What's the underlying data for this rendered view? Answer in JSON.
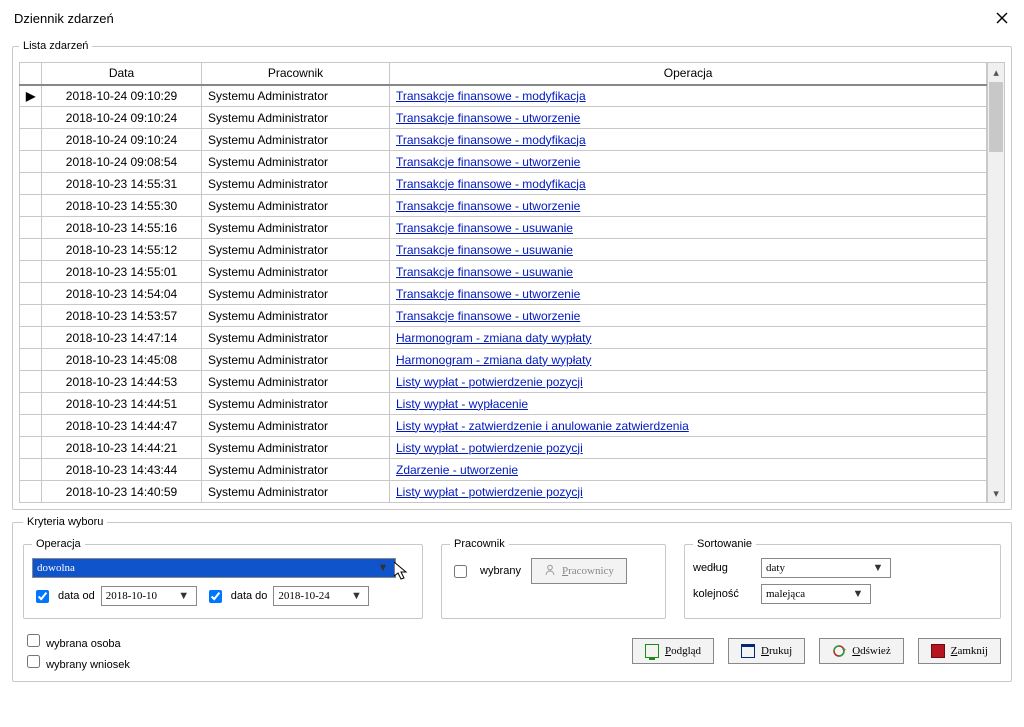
{
  "window": {
    "title": "Dziennik zdarzeń"
  },
  "fieldsets": {
    "list_title": "Lista zdarzeń",
    "criteria_title": "Kryteria wyboru",
    "operacja_title": "Operacja",
    "pracownik_title": "Pracownik",
    "sortowanie_title": "Sortowanie"
  },
  "columns": {
    "data": "Data",
    "pracownik": "Pracownik",
    "operacja": "Operacja"
  },
  "rows": [
    {
      "data": "2018-10-24 09:10:29",
      "pracownik": "Systemu Administrator",
      "operacja": "Transakcje finansowe - modyfikacja",
      "indicator": "▶"
    },
    {
      "data": "2018-10-24 09:10:24",
      "pracownik": "Systemu Administrator",
      "operacja": "Transakcje finansowe - utworzenie"
    },
    {
      "data": "2018-10-24 09:10:24",
      "pracownik": "Systemu Administrator",
      "operacja": "Transakcje finansowe - modyfikacja"
    },
    {
      "data": "2018-10-24 09:08:54",
      "pracownik": "Systemu Administrator",
      "operacja": "Transakcje finansowe - utworzenie"
    },
    {
      "data": "2018-10-23 14:55:31",
      "pracownik": "Systemu Administrator",
      "operacja": "Transakcje finansowe - modyfikacja"
    },
    {
      "data": "2018-10-23 14:55:30",
      "pracownik": "Systemu Administrator",
      "operacja": "Transakcje finansowe - utworzenie"
    },
    {
      "data": "2018-10-23 14:55:16",
      "pracownik": "Systemu Administrator",
      "operacja": "Transakcje finansowe - usuwanie"
    },
    {
      "data": "2018-10-23 14:55:12",
      "pracownik": "Systemu Administrator",
      "operacja": "Transakcje finansowe - usuwanie"
    },
    {
      "data": "2018-10-23 14:55:01",
      "pracownik": "Systemu Administrator",
      "operacja": "Transakcje finansowe - usuwanie"
    },
    {
      "data": "2018-10-23 14:54:04",
      "pracownik": "Systemu Administrator",
      "operacja": "Transakcje finansowe - utworzenie"
    },
    {
      "data": "2018-10-23 14:53:57",
      "pracownik": "Systemu Administrator",
      "operacja": "Transakcje finansowe - utworzenie"
    },
    {
      "data": "2018-10-23 14:47:14",
      "pracownik": "Systemu Administrator",
      "operacja": "Harmonogram - zmiana daty wypłaty"
    },
    {
      "data": "2018-10-23 14:45:08",
      "pracownik": "Systemu Administrator",
      "operacja": "Harmonogram - zmiana daty wypłaty"
    },
    {
      "data": "2018-10-23 14:44:53",
      "pracownik": "Systemu Administrator",
      "operacja": "Listy wypłat - potwierdzenie pozycji"
    },
    {
      "data": "2018-10-23 14:44:51",
      "pracownik": "Systemu Administrator",
      "operacja": " Listy wypłat - wypłacenie"
    },
    {
      "data": "2018-10-23 14:44:47",
      "pracownik": "Systemu Administrator",
      "operacja": "Listy wypłat - zatwierdzenie i anulowanie zatwierdzenia"
    },
    {
      "data": "2018-10-23 14:44:21",
      "pracownik": "Systemu Administrator",
      "operacja": "Listy wypłat - potwierdzenie pozycji"
    },
    {
      "data": "2018-10-23 14:43:44",
      "pracownik": "Systemu Administrator",
      "operacja": "Zdarzenie - utworzenie"
    },
    {
      "data": "2018-10-23 14:40:59",
      "pracownik": "Systemu Administrator",
      "operacja": "Listy wypłat - potwierdzenie pozycji"
    }
  ],
  "operacja": {
    "combo_label": "dowolna",
    "chk_data_od_label": "data od",
    "data_od_value": "2018-10-10",
    "chk_data_do_label": "data do",
    "data_do_value": "2018-10-24"
  },
  "pracownik": {
    "chk_wybrany": "wybrany",
    "btn_pracownicy": "Pracownicy"
  },
  "sortowanie": {
    "wedlug_label": "według",
    "wedlug_value": "daty",
    "kolejnosc_label": "kolejność",
    "kolejnosc_value": "malejąca"
  },
  "extra_checks": {
    "wybrana_osoba": "wybrana osoba",
    "wybrany_wniosek": "wybrany wniosek"
  },
  "buttons": {
    "podglad": "Podgląd",
    "drukuj": "Drukuj",
    "odswiez": "Odśwież",
    "zamknij": "Zamknij"
  }
}
